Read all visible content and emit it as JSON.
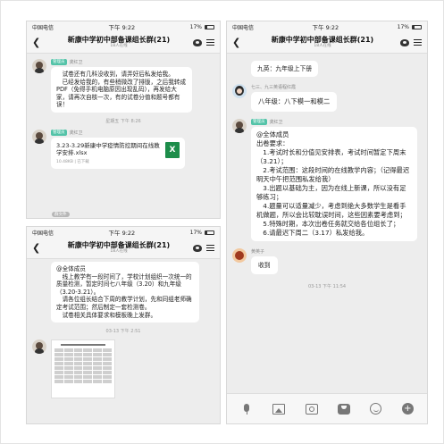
{
  "common": {
    "carrier": "中国电信",
    "time": "下午 9:22",
    "battery": "17%",
    "group_name": "新康中学初中部备课组长群(21)",
    "online": "18人在线"
  },
  "panel1": {
    "msg1": {
      "badge": "管理员",
      "sender": "龚红卫",
      "lines": [
        "试卷还有几科没收到，请弄好后私发给我。",
        "已经发给我的，有些稍微改了排版，之后我转成PDF（免得手机电脑原因出现乱码），再发给大家，请再次自核一次，有的试卷分值和题号都有误！"
      ]
    },
    "time1": "星期五 下午 8:26",
    "msg2": {
      "badge": "管理员",
      "sender": "龚红卫",
      "file_name": "3.23-3.29新康中学疫情防控期间在线教学安排.xlsx",
      "file_meta": "10.48KB | 已下载",
      "file_icon": "excel-icon",
      "file_icon_label": "X"
    },
    "cut_note": "群文件"
  },
  "panel2": {
    "msg1_lines": [
      "@全体成员",
      "线上教学有一段时间了，学校计划组织一次统一的质量检测，暂定时间七八年级（3.20）和九年级（3.20-3.21）。",
      "请各位组长结合下周的教学计划，先和同组老师确定考试范围；然后制定一套检测卷。",
      "试卷相关具体要求和模板晚上发群。"
    ],
    "time1": "03-13 下午 2:51"
  },
  "panel3": {
    "msg1": "九英：九年级上下册",
    "sender2": "七三、九三英语程红霞",
    "msg2": "八年级：八下模一和模二",
    "msg3": {
      "badge": "管理员",
      "sender": "龚红卫",
      "lines": [
        "@全体成员",
        "出卷要求：",
        "1.考试时长和分值见安排表，考试时间暂定下周末（3.21）；",
        "2.考试范围：这段时间的在线教学内容；（记得最迟明天中午把范围私发给我）",
        "3.出题以基础为主，因为在线上新课，所以没有足够练习；",
        "4.题量可以适量减少，考虑到绝大多数学生是看手机做题，所以会比较耽误时间，这些因素要考虑到；",
        "5.特殊时期，本次出卷任务就交给各位组长了；",
        "6.请最迟下周二（3.17）私发给我。"
      ]
    },
    "sender4": "黄英子",
    "msg4": "收到",
    "time1": "03-13 下午 11:54"
  }
}
